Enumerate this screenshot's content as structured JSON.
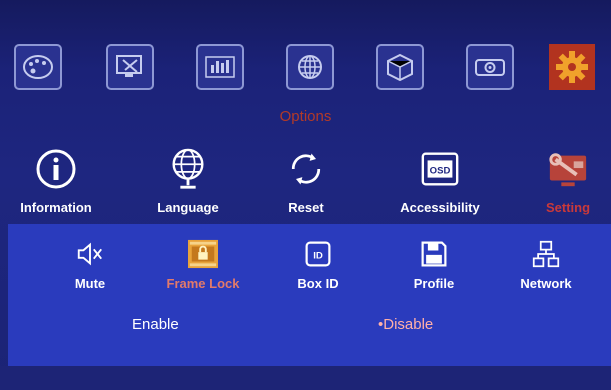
{
  "header": {
    "title": "Options"
  },
  "categories": [
    {
      "icon": "palette-icon"
    },
    {
      "icon": "display-tools-icon"
    },
    {
      "icon": "equalizer-icon"
    },
    {
      "icon": "globe-grid-icon"
    },
    {
      "icon": "3d-cube-icon"
    },
    {
      "icon": "projector-icon"
    },
    {
      "icon": "gear-icon",
      "selected": true
    }
  ],
  "menu": [
    {
      "label": "Information",
      "icon": "info-icon"
    },
    {
      "label": "Language",
      "icon": "globe-icon"
    },
    {
      "label": "Reset",
      "icon": "reset-icon"
    },
    {
      "label": "Accessibility",
      "icon": "osd-icon",
      "icon_text": "OSD"
    },
    {
      "label": "Setting",
      "icon": "wrench-setting-icon",
      "selected": true
    }
  ],
  "submenu": [
    {
      "label": "Mute",
      "icon": "speaker-mute-icon"
    },
    {
      "label": "Frame Lock",
      "icon": "frame-lock-icon",
      "selected": true
    },
    {
      "label": "Box ID",
      "icon": "id-badge-icon",
      "icon_text": "ID"
    },
    {
      "label": "Profile",
      "icon": "floppy-disk-icon"
    },
    {
      "label": "Network",
      "icon": "network-icon"
    }
  ],
  "options": [
    {
      "label": "Enable"
    },
    {
      "label": "•Disable",
      "selected": true
    }
  ],
  "colors": {
    "background": "#1e2680",
    "panel": "#2a3bbd",
    "active_red": "#c9393a",
    "selected_orange": "#e8a33b"
  }
}
